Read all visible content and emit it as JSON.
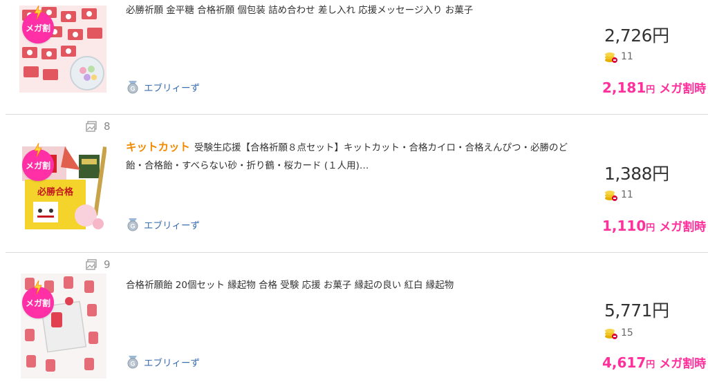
{
  "products": [
    {
      "image_count": "",
      "brand": "",
      "title": "必勝祈願 金平糖 合格祈願 個包装 詰め合わせ 差し入れ 応援メッセージ入り お菓子",
      "shop": "エブリィーず",
      "price": "2,726円",
      "points": "11",
      "mega_price_value": "2,181",
      "mega_price_yen": "円",
      "mega_label": "メガ割時",
      "badge": "メガ割"
    },
    {
      "image_count": "8",
      "brand": "キットカット",
      "title": "受験生応援【合格祈願８点セット】キットカット・合格カイロ・合格えんぴつ・必勝のど飴・合格飴・すべらない砂・折り鶴・桜カード (１人用)…",
      "shop": "エブリィーず",
      "price": "1,388円",
      "points": "11",
      "mega_price_value": "1,110",
      "mega_price_yen": "円",
      "mega_label": "メガ割時",
      "badge": "メガ割"
    },
    {
      "image_count": "9",
      "brand": "",
      "title": "合格祈願飴 20個セット 縁起物 合格 受験 応援 お菓子 縁起の良い 紅白 縁起物",
      "shop": "エブリィーず",
      "price": "5,771円",
      "points": "15",
      "mega_price_value": "4,617",
      "mega_price_yen": "円",
      "mega_label": "メガ割時",
      "badge": "メガ割"
    }
  ],
  "icons": {
    "image_count": "image-stack-icon",
    "shop": "shop-badge-icon",
    "points": "coin-stack-icon",
    "badge": "lightning-icon"
  },
  "colors": {
    "mega_pink": "#ff2f9b",
    "brand_orange": "#f08a00",
    "shop_blue": "#3e6fb0"
  }
}
